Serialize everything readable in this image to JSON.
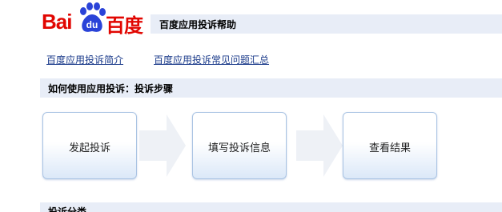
{
  "logo": {
    "text_bai": "Bai",
    "text_du": "du",
    "text_cn": "百度"
  },
  "header": {
    "title": "百度应用投诉帮助"
  },
  "links": [
    {
      "label": "百度应用投诉简介"
    },
    {
      "label": "百度应用投诉常见问题汇总"
    }
  ],
  "section": {
    "title": "如何使用应用投诉：投诉步骤"
  },
  "steps": [
    {
      "label": "发起投诉"
    },
    {
      "label": "填写投诉信息"
    },
    {
      "label": "查看结果"
    }
  ],
  "section2": {
    "title": "投诉分类"
  },
  "colors": {
    "brand_red": "#e10601",
    "brand_blue": "#2a43d8",
    "bar_bg": "#e8edf7",
    "link": "#1a3a8a"
  },
  "icons": {
    "logo_paw": "paw-icon",
    "step_arrow": "arrow-right-icon"
  }
}
